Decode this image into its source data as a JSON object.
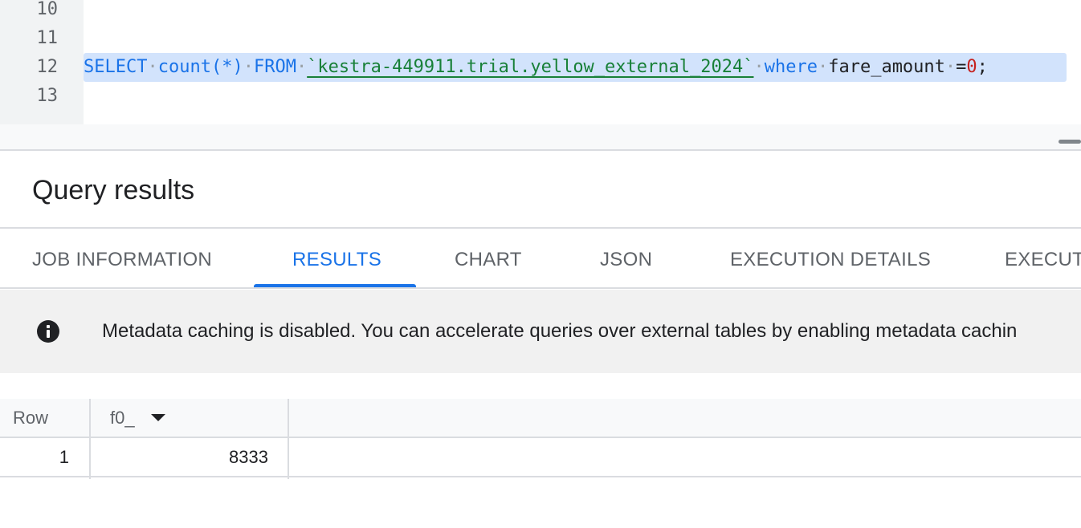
{
  "editor": {
    "lines": [
      {
        "num": "10"
      },
      {
        "num": "11"
      },
      {
        "num": "12"
      },
      {
        "num": "13"
      }
    ],
    "sql": {
      "kw_select": "SELECT",
      "fn_count": "count(*)",
      "kw_from": "FROM",
      "table": "`kestra-449911.trial.yellow_external_2024`",
      "kw_where": "where",
      "column": "fare_amount",
      "op": "=",
      "value": "0",
      "terminator": ";"
    }
  },
  "results": {
    "title": "Query results",
    "tabs": [
      {
        "label": "JOB INFORMATION"
      },
      {
        "label": "RESULTS"
      },
      {
        "label": "CHART"
      },
      {
        "label": "JSON"
      },
      {
        "label": "EXECUTION DETAILS"
      },
      {
        "label": "EXECUT"
      }
    ],
    "active_tab": "RESULTS",
    "banner": {
      "icon": "info-icon",
      "text": "Metadata caching is disabled. You can accelerate queries over external tables by enabling metadata cachin"
    },
    "table": {
      "headers": [
        "Row",
        "f0_"
      ],
      "rows": [
        {
          "row": "1",
          "value": "8333"
        }
      ]
    }
  },
  "colors": {
    "accent": "#1a73e8",
    "selection": "#d2e3fc",
    "string": "#188038",
    "number": "#c5221f"
  }
}
